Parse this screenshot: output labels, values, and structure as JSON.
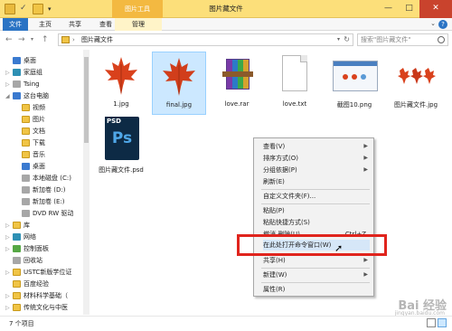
{
  "titlebar": {
    "context_tab": "图片工具",
    "title": "图片藏文件",
    "controls": {
      "min": "—",
      "max": "□",
      "close": "✕"
    }
  },
  "ribbon": {
    "tabs": [
      "文件",
      "主页",
      "共享",
      "查看",
      "管理"
    ]
  },
  "address": {
    "separator": "›",
    "path": "图片藏文件",
    "search_placeholder": "搜索\"图片藏文件\""
  },
  "sidebar": {
    "items": [
      {
        "label": "桌面"
      },
      {
        "label": "家庭组"
      },
      {
        "label": "Tsing"
      },
      {
        "label": "这台电脑"
      },
      {
        "label": "视频"
      },
      {
        "label": "图片"
      },
      {
        "label": "文档"
      },
      {
        "label": "下载"
      },
      {
        "label": "音乐"
      },
      {
        "label": "桌面"
      },
      {
        "label": "本地磁盘 (C:)"
      },
      {
        "label": "新加卷 (D:)"
      },
      {
        "label": "新加卷 (E:)"
      },
      {
        "label": "DVD RW 驱动"
      },
      {
        "label": "库"
      },
      {
        "label": "网络"
      },
      {
        "label": "控制面板"
      },
      {
        "label": "回收站"
      },
      {
        "label": "USTC新版学位证"
      },
      {
        "label": "百度经验"
      },
      {
        "label": "材料科学基础（"
      },
      {
        "label": "传统文化与中医"
      }
    ]
  },
  "files": [
    {
      "name": "1.jpg"
    },
    {
      "name": "final.jpg"
    },
    {
      "name": "love.rar"
    },
    {
      "name": "love.txt"
    },
    {
      "name": "截图10.png"
    },
    {
      "name": "图片藏文件.jpg"
    },
    {
      "name": "图片藏文件.psd",
      "badge": "PSD",
      "glyph": "Ps"
    }
  ],
  "context_menu": {
    "items": [
      "查看(V)",
      "排序方式(O)",
      "分组依据(P)",
      "刷新(E)",
      "自定义文件夹(F)...",
      "粘贴(P)",
      "粘贴快捷方式(S)",
      "撤消 删除(U)",
      "在此处打开命令窗口(W)",
      "共享(H)",
      "新建(W)",
      "属性(R)"
    ],
    "undo_shortcut": "Ctrl+Z"
  },
  "status": {
    "count": "7 个项目"
  },
  "watermark": {
    "text": "Bai 经验",
    "url": "jingyan.baidu.com"
  },
  "colors": {
    "titlebar": "#fcdf7a",
    "file_tab": "#2a73c4",
    "highlight_box": "#e0241d"
  }
}
